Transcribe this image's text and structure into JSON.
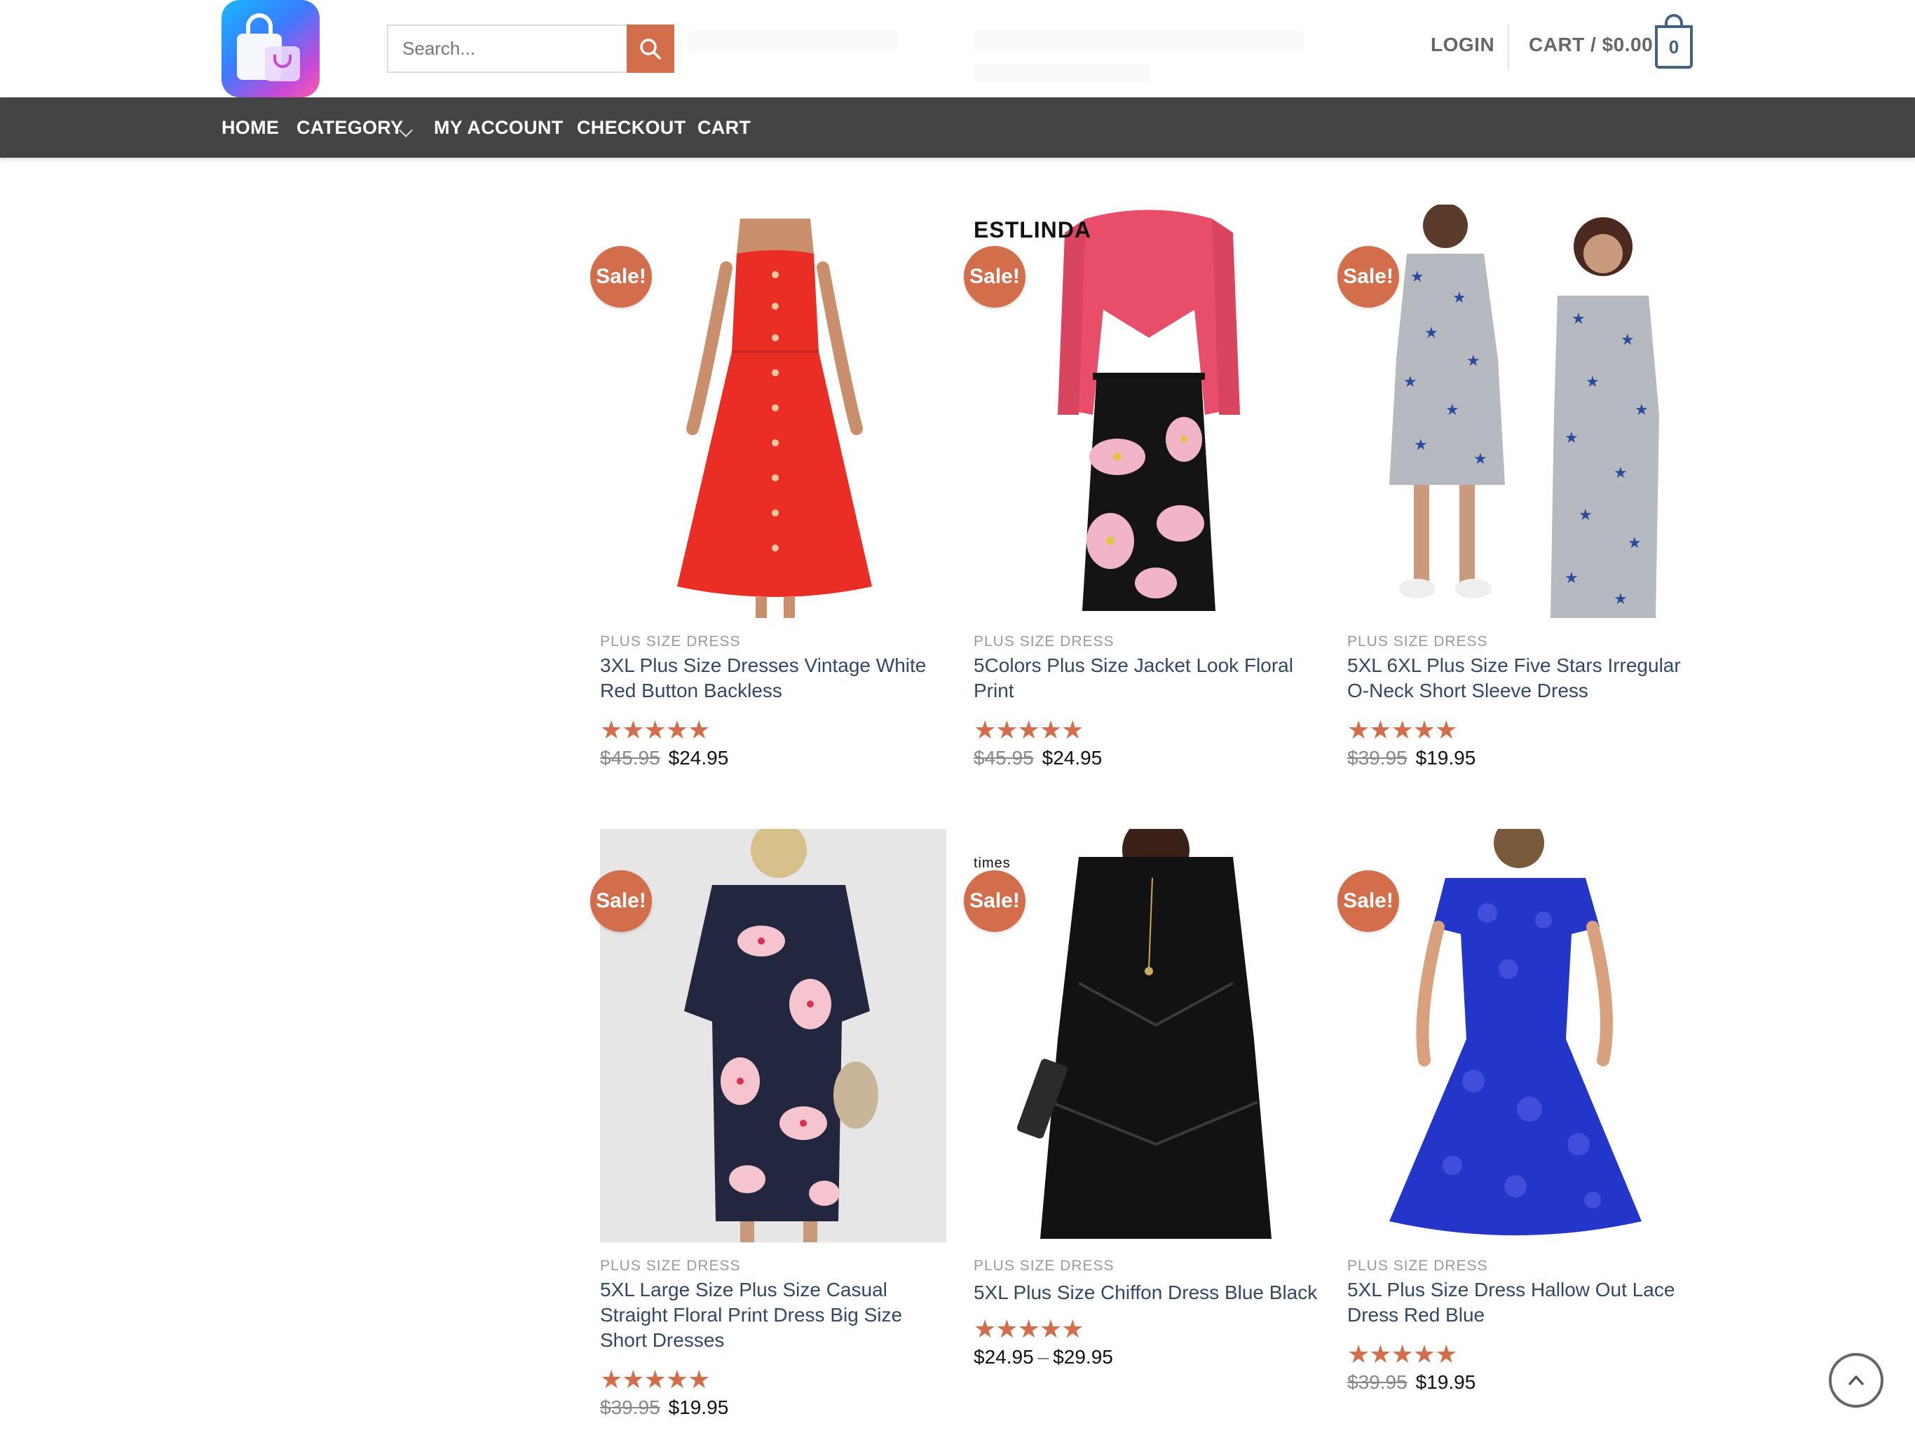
{
  "header": {
    "search_placeholder": "Search...",
    "login_label": "LOGIN",
    "cart_label": "CART / $0.00",
    "cart_count": "0"
  },
  "nav": {
    "items": [
      {
        "label": "HOME"
      },
      {
        "label": "CATEGORY"
      },
      {
        "label": "MY ACCOUNT"
      },
      {
        "label": "CHECKOUT"
      },
      {
        "label": "CART"
      }
    ]
  },
  "sale_badge": "Sale!",
  "products": [
    {
      "category": "PLUS SIZE DRESS",
      "title": "3XL Plus Size Dresses Vintage White Red Button Backless",
      "rating": 5,
      "old_price": "$45.95",
      "price": "$24.95"
    },
    {
      "category": "PLUS SIZE DRESS",
      "title": "5Colors Plus Size Jacket Look Floral Print",
      "rating": 5,
      "old_price": "$45.95",
      "price": "$24.95",
      "image_text": "ESTLINDA"
    },
    {
      "category": "PLUS SIZE DRESS",
      "title": "5XL 6XL Plus Size Five Stars Irregular O-Neck Short Sleeve Dress",
      "rating": 5,
      "old_price": "$39.95",
      "price": "$19.95"
    },
    {
      "category": "PLUS SIZE DRESS",
      "title": "5XL Large Size Plus Size Casual Straight Floral Print Dress Big Size Short Dresses",
      "rating": 5,
      "old_price": "$39.95",
      "price": "$19.95"
    },
    {
      "category": "PLUS SIZE DRESS",
      "title": "5XL Plus Size Chiffon Dress Blue Black",
      "rating": 5,
      "price_min": "$24.95",
      "price_sep": "–",
      "price_max": "$29.95",
      "image_text": "times"
    },
    {
      "category": "PLUS SIZE DRESS",
      "title": "5XL Plus Size Dress Hallow Out Lace Dress Red Blue",
      "rating": 5,
      "old_price": "$39.95",
      "price": "$19.95"
    }
  ],
  "icons": {
    "logo": "shopping-bag-icon",
    "search": "search-icon",
    "cart": "cart-bag-icon",
    "back_to_top": "chevron-up-icon",
    "rating": "star-icon"
  },
  "colors": {
    "accent": "#d26e4b",
    "nav_bg": "#444444",
    "link": "#334862",
    "cart_border": "#446084"
  }
}
